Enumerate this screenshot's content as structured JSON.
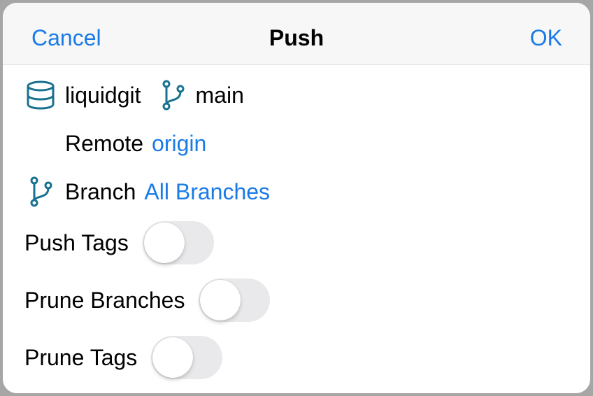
{
  "navbar": {
    "cancel_label": "Cancel",
    "title": "Push",
    "ok_label": "OK"
  },
  "repo": {
    "icon": "database-icon",
    "name": "liquidgit",
    "branch_icon": "git-branch-icon",
    "branch": "main"
  },
  "remote": {
    "label": "Remote",
    "value": "origin"
  },
  "branch_row": {
    "icon": "git-branch-icon",
    "label": "Branch",
    "value": "All Branches"
  },
  "toggles": [
    {
      "label": "Push Tags",
      "on": false
    },
    {
      "label": "Prune Branches",
      "on": false
    },
    {
      "label": "Prune Tags",
      "on": false
    }
  ],
  "colors": {
    "accent": "#1a7be6",
    "icon": "#17718f",
    "toggle_off": "#e9e9eb"
  }
}
